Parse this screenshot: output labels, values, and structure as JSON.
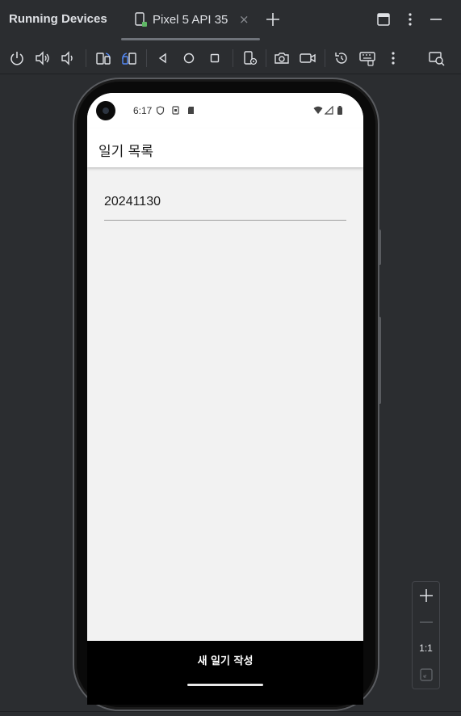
{
  "window": {
    "title": "Running Devices",
    "tab_label": "Pixel 5 API 35",
    "tab_close": "×"
  },
  "icons": {
    "title_bar": [
      "device-icon",
      "close-icon",
      "add-icon",
      "layout-icon",
      "more-icon",
      "minimize-icon"
    ],
    "toolbar": [
      "power-icon",
      "volume-up-icon",
      "volume-down-icon",
      "rotate-left-icon",
      "rotate-right-icon",
      "back-icon",
      "home-icon",
      "overview-icon",
      "device-settings-icon",
      "screenshot-icon",
      "screen-record-icon",
      "reset-icon",
      "keyboard-icon",
      "more-icon",
      "layout-inspector-icon"
    ],
    "status_bar": [
      "shield-icon",
      "sim-icon",
      "sd-card-icon",
      "wifi-icon",
      "signal-icon",
      "battery-icon"
    ],
    "zoom": [
      "zoom-in-icon",
      "zoom-out-icon",
      "fit-icon"
    ]
  },
  "device": {
    "status_time": "6:17",
    "app_title": "일기 목록",
    "list_items": [
      {
        "text": "20241130"
      }
    ],
    "bottom_button": "새 일기 작성"
  },
  "zoom": {
    "level_label": "1:1"
  },
  "colors": {
    "ide_background": "#2b2d30",
    "ide_text": "#dfe1e5",
    "accent_blue": "#548af7",
    "accent_green": "#5fb865",
    "app_bar": "#ffffff",
    "screen_background": "#f2f2f2",
    "bottom_bar": "#000000"
  }
}
